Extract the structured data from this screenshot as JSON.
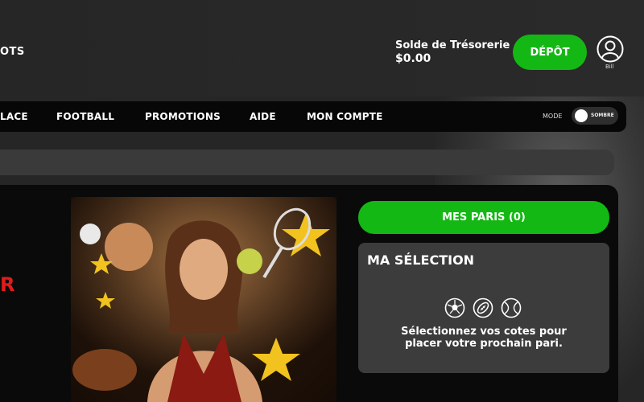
{
  "header": {
    "brand": "OTS",
    "treasury_label": "Solde de Trésorerie",
    "treasury_amount": "$0.00",
    "deposit_label": "DÉPÔT",
    "user_name": "Bill"
  },
  "nav": {
    "items": [
      "LACE",
      "FOOTBALL",
      "PROMOTIONS",
      "AIDE",
      "MON COMPTE"
    ],
    "mode_label": "MODE",
    "mode_value": "SOMBRE"
  },
  "promo": {
    "partial_text": "R"
  },
  "betslip": {
    "my_bets_label": "MES PARIS (0)",
    "selection_title": "MA SÉLECTION",
    "sport_icons": [
      "soccer-ball-icon",
      "american-football-icon",
      "tennis-ball-icon"
    ],
    "empty_message": "Sélectionnez vos cotes pour placer votre prochain pari."
  },
  "colors": {
    "accent_green": "#14b814",
    "promo_red": "#e21b1b",
    "background": "#262626"
  }
}
